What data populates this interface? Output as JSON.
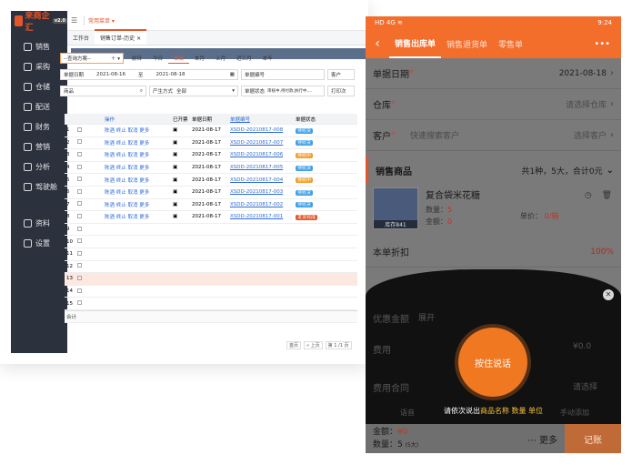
{
  "desktop": {
    "logo": "來商企汇",
    "version": "v2.0",
    "top_menu": "常用菜单 ▾",
    "sidebar": [
      {
        "label": "销售"
      },
      {
        "label": "采购"
      },
      {
        "label": "仓储"
      },
      {
        "label": "配送"
      },
      {
        "label": "财务"
      },
      {
        "label": "营销"
      },
      {
        "label": "分析"
      },
      {
        "label": "驾驶舱"
      }
    ],
    "sidebar_bottom": [
      {
        "label": "资料"
      },
      {
        "label": "设置"
      }
    ],
    "tabs": [
      "工作台",
      "销售订单-历史"
    ],
    "filters": {
      "scheme": "--查询方案--",
      "quick": [
        "前日",
        "今日",
        "本周",
        "本月",
        "上月",
        "近三月",
        "本年"
      ],
      "date_label": "单据日期",
      "date_from": "2021-08-16",
      "date_to_label": "至",
      "date_to": "2021-08-18",
      "billno_label": "单据编号",
      "customer_label": "客户",
      "product_label": "商品",
      "method_label": "产生方式",
      "method_value": "全部",
      "status_label": "单据状态",
      "status_value": "审核中,待付款,执行中,…",
      "print_label": "打印次"
    },
    "grid": {
      "headers": [
        "",
        "",
        "操作",
        "已开票",
        "单据日期",
        "单据编号",
        "单据状态"
      ],
      "actions": "陈酒  终止  取消  更多",
      "rows": [
        {
          "no": "1",
          "date": "2021-08-17",
          "bill": "XSDD-20210817-008",
          "status": "待收货",
          "kind": "b"
        },
        {
          "no": "2",
          "date": "2021-08-17",
          "bill": "XSDD-20210817-007",
          "status": "待收货",
          "kind": "b"
        },
        {
          "no": "3",
          "date": "2021-08-17",
          "bill": "XSDD-20210817-006",
          "status": "待收中",
          "kind": "o"
        },
        {
          "no": "4",
          "date": "2021-08-17",
          "bill": "XSDD-20210817-005",
          "status": "待收货",
          "kind": "b"
        },
        {
          "no": "5",
          "date": "2021-08-17",
          "bill": "XSDD-20210817-004",
          "status": "待收中",
          "kind": "o"
        },
        {
          "no": "6",
          "date": "2021-08-17",
          "bill": "XSDD-20210817-003",
          "status": "待收货",
          "kind": "b"
        },
        {
          "no": "7",
          "date": "2021-08-17",
          "bill": "XSDD-20210817-002",
          "status": "待收货",
          "kind": "b"
        },
        {
          "no": "8",
          "date": "2021-08-17",
          "bill": "XSDD-20210817-001",
          "status": "发货完成",
          "kind": "r"
        }
      ],
      "empty_rows": [
        "9",
        "10",
        "11",
        "12",
        "13",
        "14",
        "15"
      ],
      "sum_label": "合计"
    },
    "pager": {
      "first": "首页",
      "prev": "« 上页",
      "page": "第 1 /1 页"
    }
  },
  "phone": {
    "status_time": "9:24",
    "status_left": "HD 4G ≋",
    "tabs": [
      "销售出库单",
      "销售退货单",
      "零售单"
    ],
    "more": "•••",
    "date_label": "单据日期",
    "date_value": "2021-08-18",
    "warehouse_label": "仓库",
    "warehouse_placeholder": "请选择仓库",
    "customer_label": "客户",
    "customer_search": "快速搜索客户",
    "customer_placeholder": "选择客户",
    "section_title": "销售商品",
    "section_summary": "共1种，5大，合计0元",
    "product": {
      "name": "复合袋米花糖",
      "qty_label": "数量：",
      "qty": "5",
      "amount_label": "金额：",
      "amount": "0",
      "price_label": "单价：",
      "price": "0/箱",
      "stock": "库存841"
    },
    "discount_label": "本单折扣",
    "discount_pct": "100%",
    "offer_label": "优惠金额",
    "offer_hint": "展开",
    "fee_label": "费用",
    "fee_value": "¥0.0",
    "fee_contract_label": "费用合同",
    "fee_contract_hint": "请选择",
    "voice_button": "按住说话",
    "voice_hint_pre": "请依次说出",
    "voice_hint_a": "商品名称",
    "voice_hint_b": "数量",
    "voice_hint_c": "单位",
    "behind_voice": "语音",
    "behind_manual": "手动添加",
    "footer": {
      "amount_label": "金额：",
      "amount": "¥0",
      "qty_label": "数量：",
      "qty": "5",
      "qty_unit": "(5大)",
      "more": "更多",
      "save": "记账"
    }
  }
}
